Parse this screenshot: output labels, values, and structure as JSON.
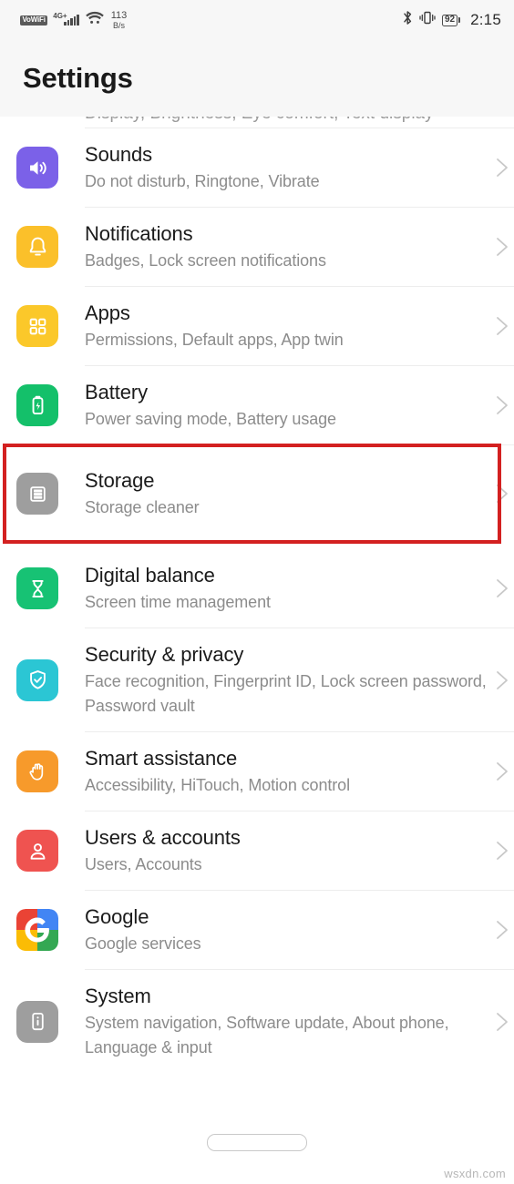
{
  "statusbar": {
    "vowifi_label": "VoWiFi",
    "network_type": "4G+",
    "net_speed_value": "113",
    "net_speed_unit": "B/s",
    "battery_percent": "92",
    "clock": "2:15",
    "icons": [
      "vowifi-icon",
      "signal-bars-icon",
      "wifi-icon",
      "bluetooth-icon",
      "vibrate-icon",
      "battery-icon"
    ]
  },
  "header": {
    "title": "Settings"
  },
  "list": {
    "clipped_top_text": "Display, Brightness, Eye comfort, Text display",
    "items": [
      {
        "title": "Sounds",
        "subtitle": "Do not disturb, Ringtone, Vibrate",
        "icon": "volume-speaker-icon",
        "color": "#7b61e8"
      },
      {
        "title": "Notifications",
        "subtitle": "Badges, Lock screen notifications",
        "icon": "bell-icon",
        "color": "#fbc02a"
      },
      {
        "title": "Apps",
        "subtitle": "Permissions, Default apps, App twin",
        "icon": "app-grid-icon",
        "color": "#fbc82a"
      },
      {
        "title": "Battery",
        "subtitle": "Power saving mode, Battery usage",
        "icon": "battery-bolt-icon",
        "color": "#14c06a"
      },
      {
        "title": "Storage",
        "subtitle": "Storage cleaner",
        "icon": "storage-stack-icon",
        "color": "#9e9e9e",
        "highlighted": true
      },
      {
        "title": "Digital balance",
        "subtitle": "Screen time management",
        "icon": "hourglass-icon",
        "color": "#17c274"
      },
      {
        "title": "Security & privacy",
        "subtitle": "Face recognition, Fingerprint ID, Lock screen password, Password vault",
        "icon": "shield-check-icon",
        "color": "#2bc6d4"
      },
      {
        "title": "Smart assistance",
        "subtitle": "Accessibility, HiTouch, Motion control",
        "icon": "hand-icon",
        "color": "#f79a2b"
      },
      {
        "title": "Users & accounts",
        "subtitle": "Users, Accounts",
        "icon": "person-icon",
        "color": "#ef5350"
      },
      {
        "title": "Google",
        "subtitle": "Google services",
        "icon": "google-g-icon",
        "color": "#ffffff"
      },
      {
        "title": "System",
        "subtitle": "System navigation, Software update, About phone, Language & input",
        "icon": "phone-info-icon",
        "color": "#9e9e9e"
      }
    ],
    "chevron_icon": "chevron-right-icon"
  },
  "highlight": {
    "color": "#d32020",
    "target": "Storage"
  },
  "bottom": {
    "gesture_bar": "home-gesture-bar",
    "watermark": "wsxdn.com"
  }
}
